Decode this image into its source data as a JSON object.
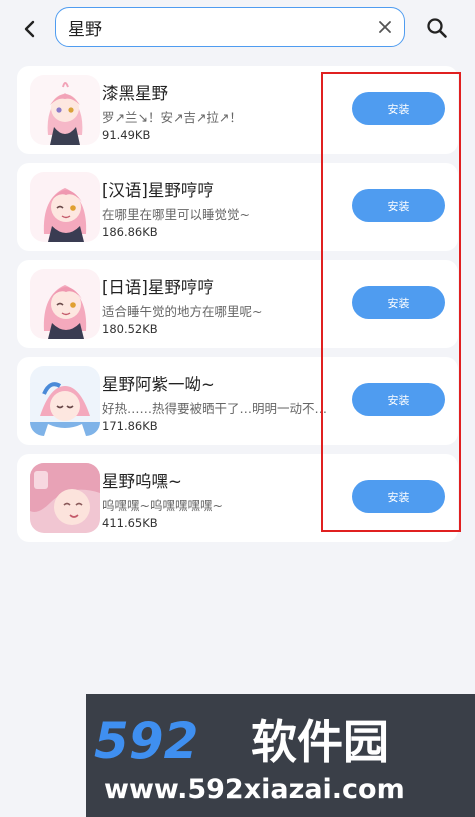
{
  "search": {
    "query": "星野"
  },
  "results": [
    {
      "title": "漆黑星野",
      "desc": "罗↗兰↘！安↗吉↗拉↗！",
      "size": "91.49KB",
      "install_label": "安装",
      "avatar": "anime-character-pink-hair-dark"
    },
    {
      "title": "[汉语]星野哼哼",
      "desc": "在哪里在哪里可以睡觉觉~",
      "size": "186.86KB",
      "install_label": "安装",
      "avatar": "anime-character-pink-hair-wink"
    },
    {
      "title": "[日语]星野哼哼",
      "desc": "适合睡午觉的地方在哪里呢~",
      "size": "180.52KB",
      "install_label": "安装",
      "avatar": "anime-character-pink-hair-wink"
    },
    {
      "title": "星野阿紫一呦~",
      "desc": "好热……热得要被晒干了…明明一动不动却还是好热",
      "size": "171.86KB",
      "install_label": "安装",
      "avatar": "anime-character-pink-hair-sleepy"
    },
    {
      "title": "星野呜嘿~",
      "desc": "呜嘿嘿~呜嘿嘿嘿嘿~",
      "size": "411.65KB",
      "install_label": "安装",
      "avatar": "anime-character-pink-hair-closeup"
    }
  ],
  "watermark": {
    "brand_number": "592",
    "brand_name": "软件园",
    "url": "www.592xiazai.com"
  },
  "colors": {
    "accent": "#4f9cf0",
    "highlight": "#e02020",
    "background": "#f3f4f8"
  }
}
